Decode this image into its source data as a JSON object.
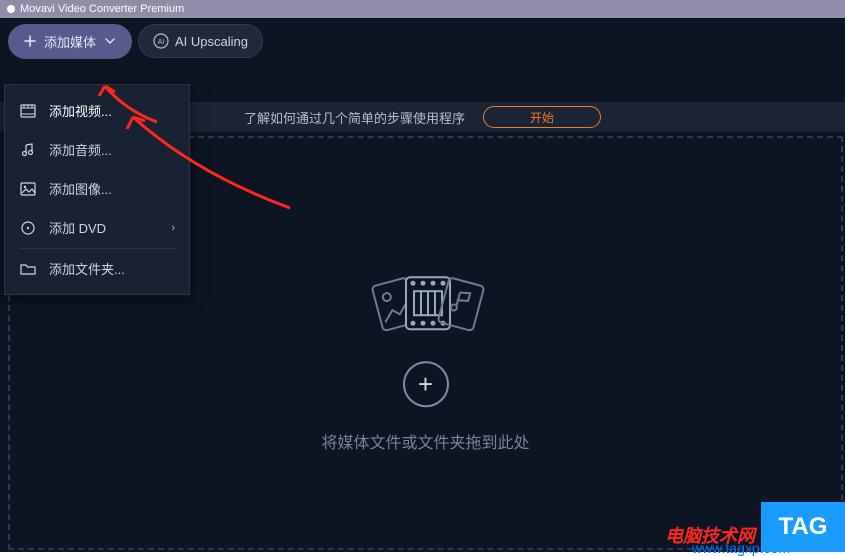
{
  "title": "Movavi Video Converter Premium",
  "toolbar": {
    "add_media": "添加媒体",
    "upscaling": "AI Upscaling"
  },
  "menu": {
    "add_video": "添加视频...",
    "add_audio": "添加音频...",
    "add_image": "添加图像...",
    "add_dvd": "添加 DVD",
    "add_folder": "添加文件夹..."
  },
  "infobar": {
    "text": "了解如何通过几个简单的步骤使用程序",
    "start": "开始"
  },
  "drop_hint": "将媒体文件或文件夹拖到此处",
  "watermark": {
    "name": "电脑技术网",
    "url": "www.tagxp.com",
    "tag": "TAG"
  }
}
